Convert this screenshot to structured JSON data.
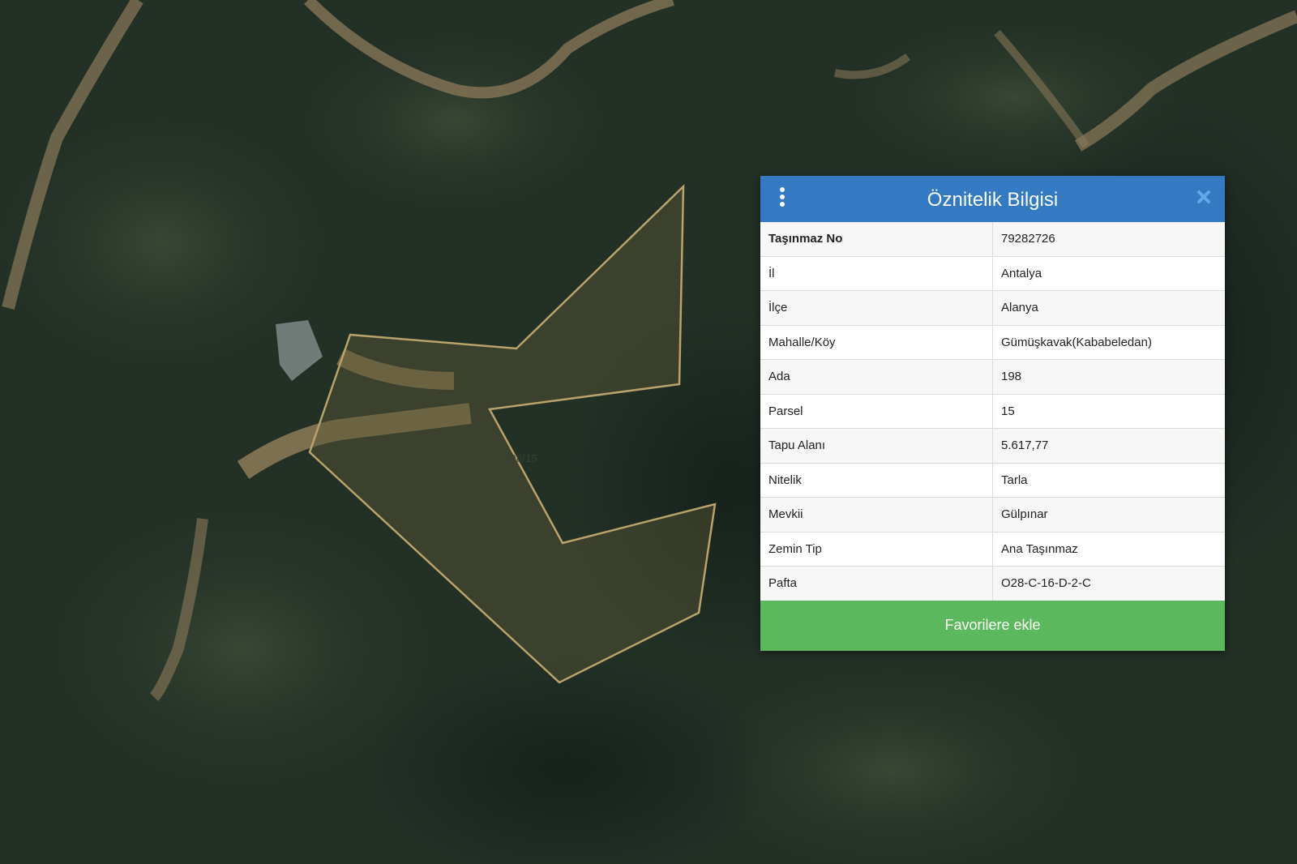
{
  "map": {
    "parcel_label": "198/15",
    "parcel_outline_color": "#b9a26b"
  },
  "panel": {
    "title": "Öznitelik Bilgisi",
    "header_color": "#337ac2",
    "menu_icon": "vertical-dots-icon",
    "close_icon": "close-icon",
    "rows": [
      {
        "key": "Taşınmaz No",
        "value": "79282726"
      },
      {
        "key": "İl",
        "value": "Antalya"
      },
      {
        "key": "İlçe",
        "value": "Alanya"
      },
      {
        "key": "Mahalle/Köy",
        "value": "Gümüşkavak(Kababeledan)"
      },
      {
        "key": "Ada",
        "value": "198"
      },
      {
        "key": "Parsel",
        "value": "15"
      },
      {
        "key": "Tapu Alanı",
        "value": "5.617,77"
      },
      {
        "key": "Nitelik",
        "value": "Tarla"
      },
      {
        "key": "Mevkii",
        "value": "Gülpınar"
      },
      {
        "key": "Zemin Tip",
        "value": "Ana Taşınmaz"
      },
      {
        "key": "Pafta",
        "value": "O28-C-16-D-2-C"
      }
    ],
    "button_label": "Favorilere ekle",
    "button_color": "#5cb85c"
  }
}
